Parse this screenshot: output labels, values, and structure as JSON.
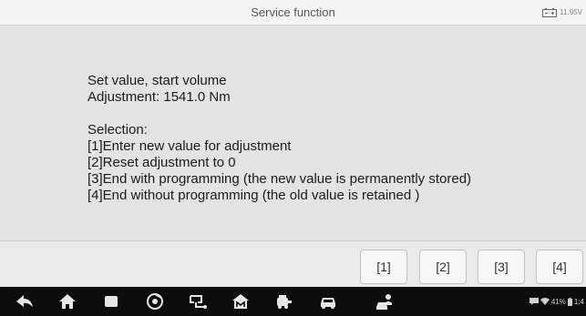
{
  "header": {
    "title": "Service function",
    "battery_voltage": "11.95V"
  },
  "message": {
    "lines": [
      "Set value, start volume",
      "Adjustment: 1541.0 Nm",
      "",
      "Selection:",
      "[1]Enter new value for adjustment",
      "[2]Reset adjustment to 0",
      "[3]End with programming (the new value is permanently stored)",
      "[4]End without programming (the old value is retained )"
    ]
  },
  "buttons": [
    {
      "label": "[1]"
    },
    {
      "label": "[2]"
    },
    {
      "label": "[3]"
    },
    {
      "label": "[4]"
    }
  ],
  "nav_bar": {
    "icons": [
      "back-icon",
      "home-icon",
      "recent-apps-icon",
      "browser-icon",
      "vci-connect-icon",
      "autel-home-icon",
      "car-diagnostics-icon",
      "car-service-icon",
      "remote-desk-icon"
    ],
    "status": {
      "battery_percent": "41%",
      "time": "1:4"
    }
  },
  "colors": {
    "background": "#e3e3e3",
    "header": "#f4f4f4",
    "nav_bar": "#0d0d0d",
    "button": "#f7f7f7"
  }
}
